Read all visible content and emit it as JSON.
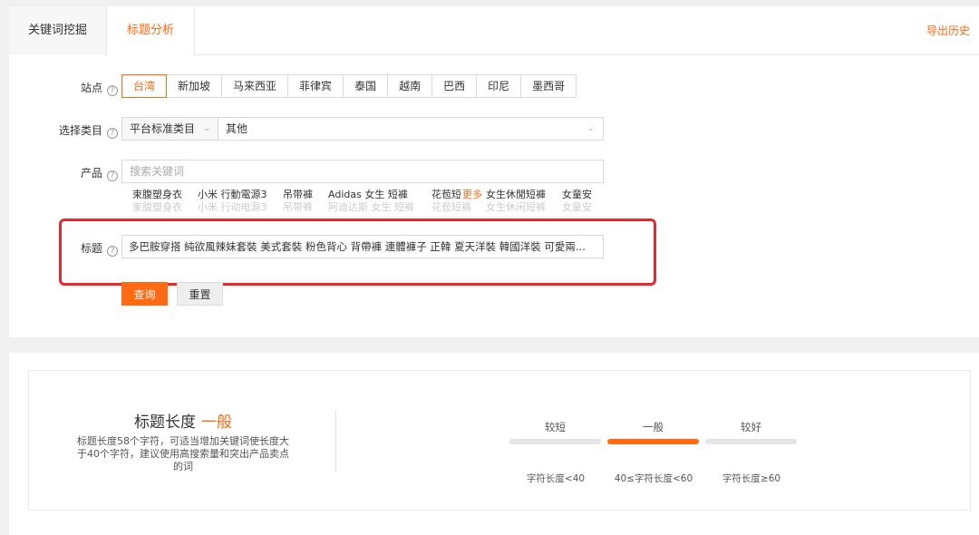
{
  "tabs": {
    "keyword_mining": "关键词挖掘",
    "title_analysis": "标题分析",
    "export_history": "导出历史"
  },
  "form": {
    "site_label": "站点",
    "category_label": "选择类目",
    "product_label": "产品",
    "title_label": "标题",
    "help_icon": "?"
  },
  "sites": [
    "台湾",
    "新加坡",
    "马来西亚",
    "菲律宾",
    "泰国",
    "越南",
    "巴西",
    "印尼",
    "墨西哥"
  ],
  "selected_site": "台湾",
  "category": {
    "first_level": "平台标准类目",
    "second_level": "其他"
  },
  "product": {
    "placeholder": "搜索关键词",
    "suggestions": [
      {
        "main": "束腹塑身衣",
        "sub": "束腹塑身衣"
      },
      {
        "main": "小米 行動電源3",
        "sub": "小米 行动电源3"
      },
      {
        "main": "吊带褲",
        "sub": "吊带裤"
      },
      {
        "main": "Adidas 女生 短褲",
        "sub": "阿迪达斯 女生 短裤"
      },
      {
        "main": "花苞短褲",
        "sub": "花苞短裤"
      },
      {
        "main": "女生休閒短褲",
        "sub": "女生休闲短裤"
      },
      {
        "main": "女童安",
        "sub": "女童安"
      }
    ],
    "more_label": "更多"
  },
  "title_value": "多巴胺穿搭 純欲風辣妹套裝 美式套裝 粉色背心 背帶褲 連體褲子 正韓 夏天洋裝 韓國洋裝 可愛兩...",
  "buttons": {
    "query": "查询",
    "reset": "重置"
  },
  "result": {
    "heading": "标题长度",
    "grade": "一般",
    "description": "标题长度58个字符，可适当增加关键词使长度大于40个字符，建议使用高搜索量和突出产品卖点的词",
    "scale": [
      {
        "label": "较短",
        "range": "字符长度<40",
        "active": false
      },
      {
        "label": "一般",
        "range": "40≤字符长度<60",
        "active": true
      },
      {
        "label": "较好",
        "range": "字符长度≥60",
        "active": false
      }
    ]
  },
  "colors": {
    "accent": "#ff6a13",
    "highlight": "#e8282b"
  }
}
